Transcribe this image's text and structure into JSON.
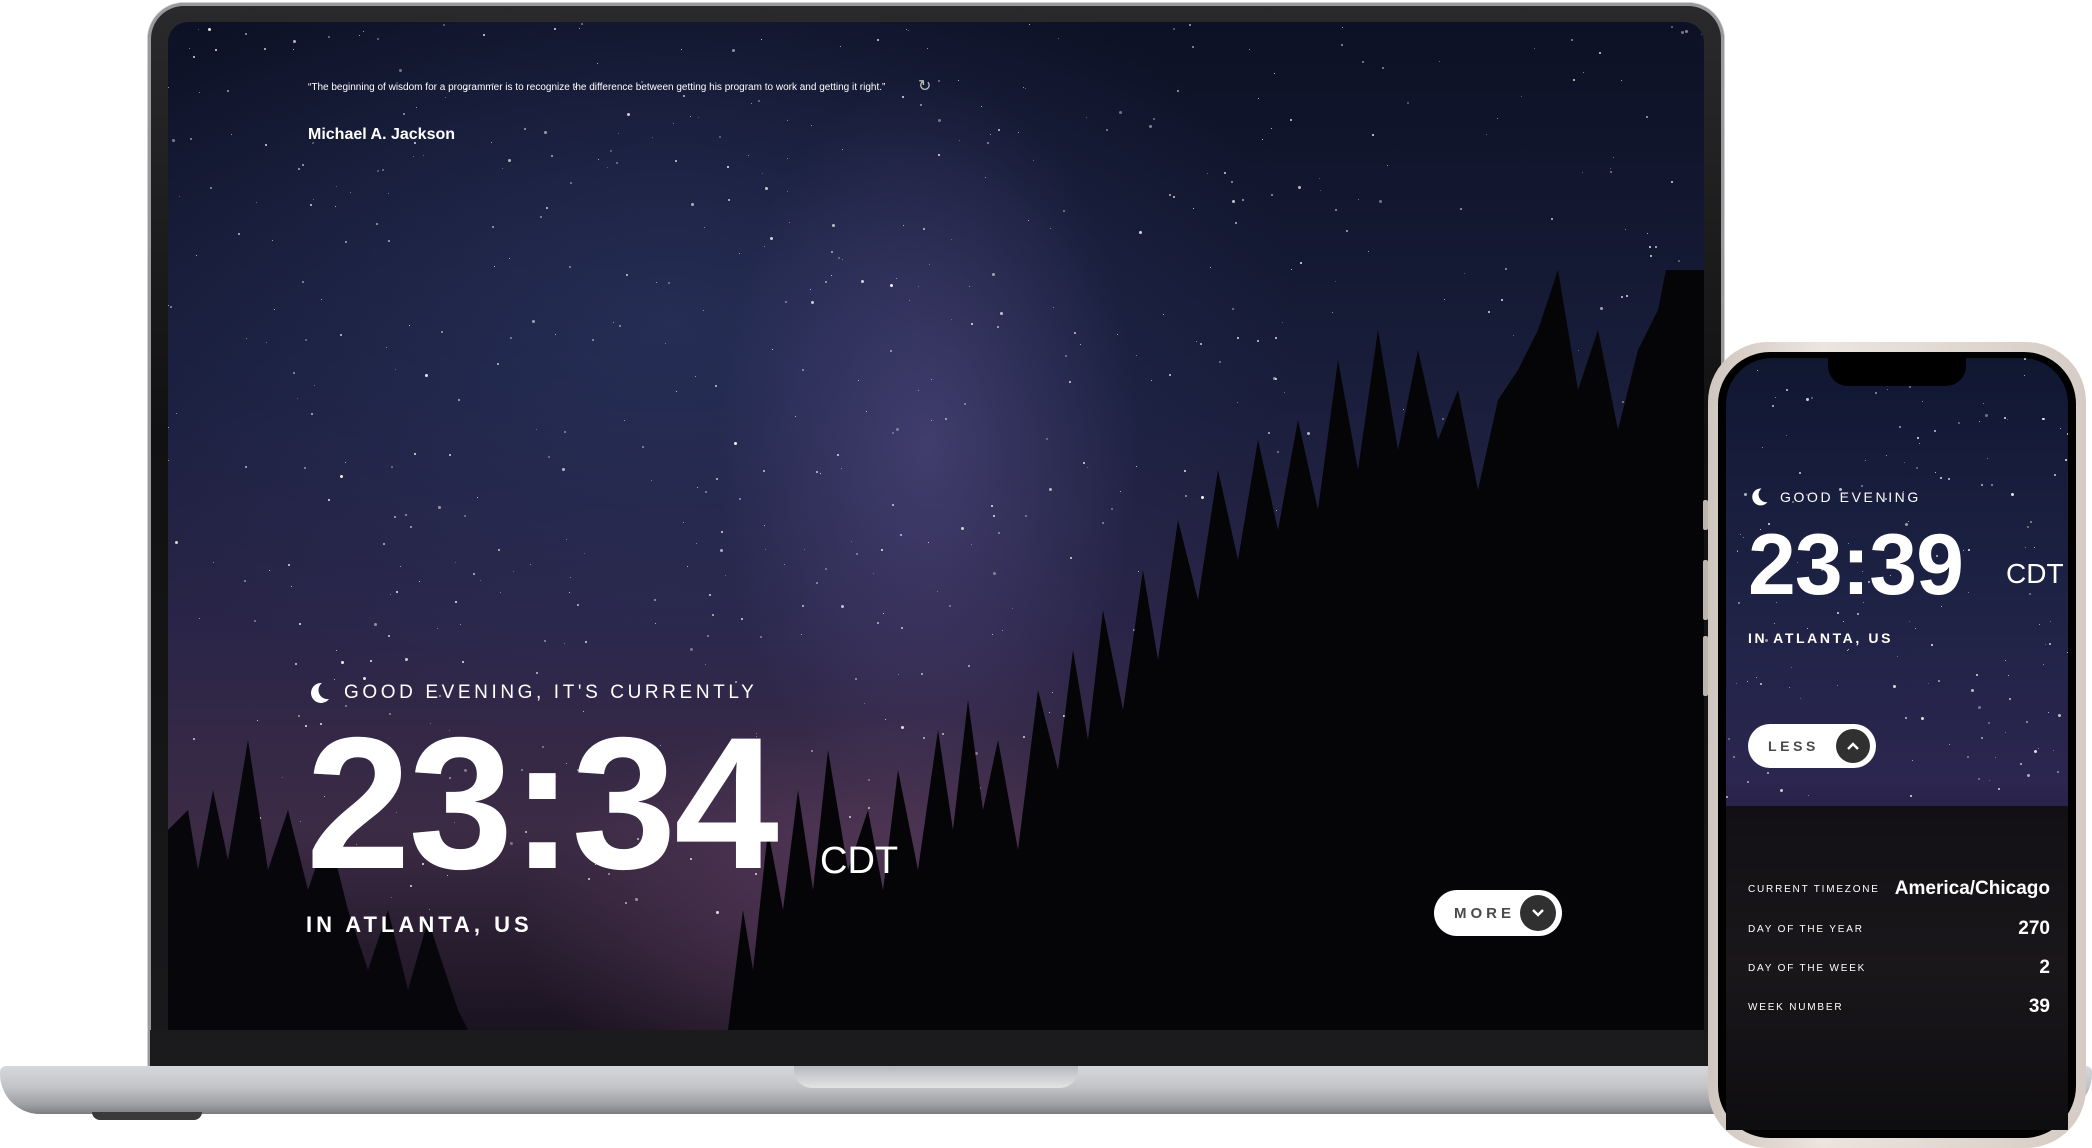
{
  "laptop": {
    "quote": "“The beginning of wisdom for a programmer is to recognize the difference between getting his program to work and getting it right.”",
    "author": "Michael A. Jackson",
    "refresh_icon": "refresh-icon",
    "greeting": "GOOD EVENING, IT'S CURRENTLY",
    "time": "23:34",
    "timezone": "CDT",
    "location": "IN ATLANTA, US",
    "more_label": "MORE",
    "more_icon": "chevron-down-icon"
  },
  "phone": {
    "greeting": "GOOD EVENING",
    "time": "23:39",
    "timezone": "CDT",
    "location": "IN ATLANTA, US",
    "less_label": "LESS",
    "less_icon": "chevron-up-icon",
    "details": [
      {
        "label": "CURRENT TIMEZONE",
        "value": "America/Chicago"
      },
      {
        "label": "DAY OF THE YEAR",
        "value": "270"
      },
      {
        "label": "DAY OF THE WEEK",
        "value": "2"
      },
      {
        "label": "WEEK NUMBER",
        "value": "39"
      }
    ]
  }
}
